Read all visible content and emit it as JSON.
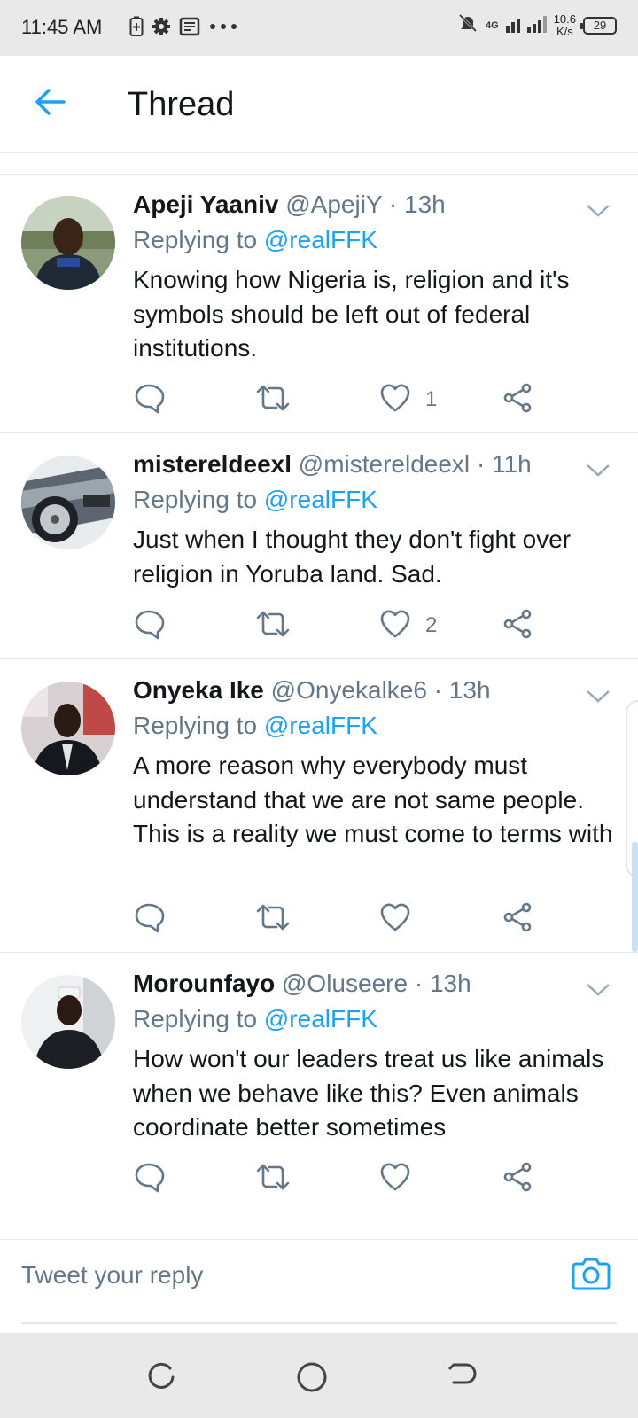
{
  "status_bar": {
    "time": "11:45 AM",
    "network": "4G",
    "speed_value": "10.6",
    "speed_unit": "K/s",
    "battery": "29"
  },
  "header": {
    "title": "Thread",
    "back_icon": "arrow-left-icon"
  },
  "colors": {
    "accent": "#1da1f2",
    "text": "#14171a",
    "muted": "#657786",
    "divider": "#e1e8ed"
  },
  "tweets": [
    {
      "display_name": "Apeji Yaaniv",
      "handle": "@ApejiY",
      "time": "13h",
      "replying_prefix": "Replying to",
      "replying_to": "@realFFK",
      "text": "Knowing how Nigeria is, religion and it's symbols should be left out of federal institutions.",
      "like_count": "1"
    },
    {
      "display_name": "mistereldeexl",
      "handle": "@mistereldeexl",
      "time": "11h",
      "replying_prefix": "Replying to",
      "replying_to": "@realFFK",
      "text": "Just when I thought they don't fight over religion in Yoruba land. Sad.",
      "like_count": "2"
    },
    {
      "display_name": "Onyeka Ike",
      "handle": "@Onyekalke6",
      "time": "13h",
      "replying_prefix": "Replying to",
      "replying_to": "@realFFK",
      "text": "A more reason why everybody must understand that we are not same people. This is a reality we must come to terms with",
      "like_count": ""
    },
    {
      "display_name": "Morounfayo",
      "handle": "@Oluseere",
      "time": "13h",
      "replying_prefix": "Replying to",
      "replying_to": "@realFFK",
      "text": "How won't our leaders treat us like animals when we behave like this? Even animals coordinate better sometimes",
      "like_count": ""
    }
  ],
  "composer": {
    "placeholder": "Tweet your reply",
    "camera_icon": "camera-icon"
  },
  "separator": "·"
}
